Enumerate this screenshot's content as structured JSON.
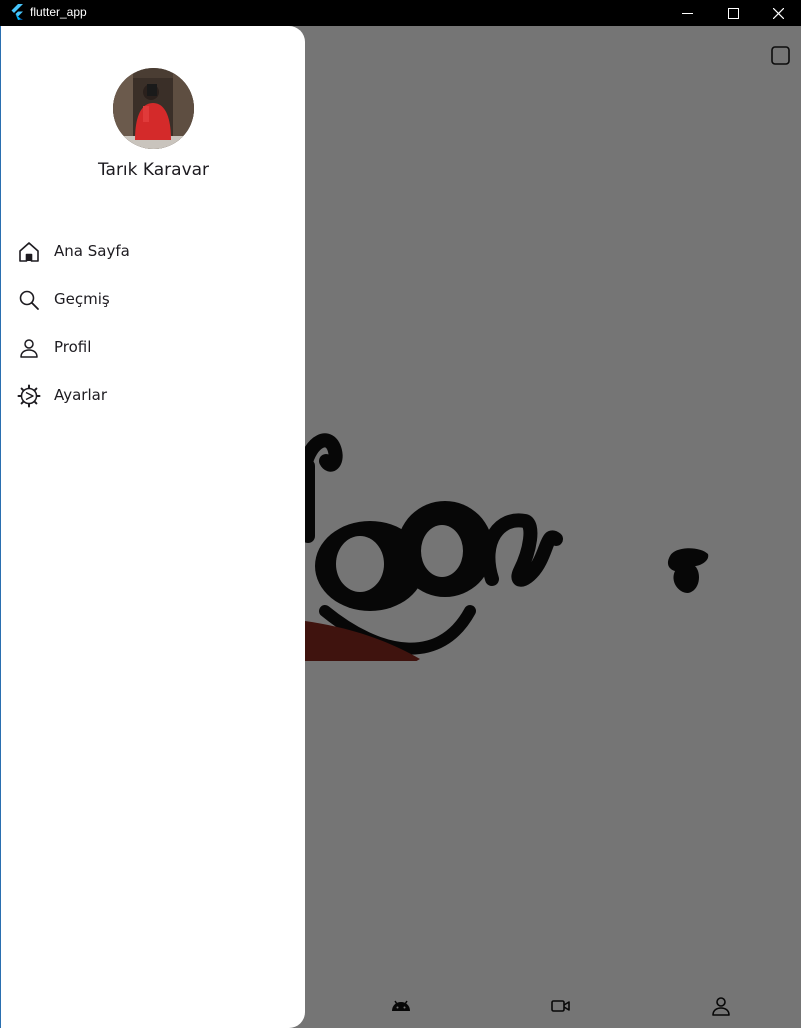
{
  "window": {
    "title": "flutter_app",
    "icon": "flutter-logo-icon",
    "controls": [
      "minimize-icon",
      "maximize-icon",
      "close-icon"
    ]
  },
  "drawer": {
    "user_name": "Tarık Karavar",
    "avatar": "user-avatar-photo",
    "items": [
      {
        "label": "Ana Sayfa",
        "icon": "home-icon"
      },
      {
        "label": "Geçmiş",
        "icon": "search-icon"
      },
      {
        "label": "Profil",
        "icon": "person-icon"
      },
      {
        "label": "Ayarlar",
        "icon": "settings-icon"
      }
    ]
  },
  "bottom_nav": {
    "items": [
      {
        "icon": "android-icon"
      },
      {
        "icon": "video-camera-icon"
      },
      {
        "icon": "person-icon"
      }
    ]
  },
  "colors": {
    "titlebar": "#000000",
    "drawer_bg": "#ffffff",
    "scrim": "#757575",
    "logo_black": "#111111",
    "logo_tongue": "#8a2a20",
    "text": "#1d1b20"
  }
}
